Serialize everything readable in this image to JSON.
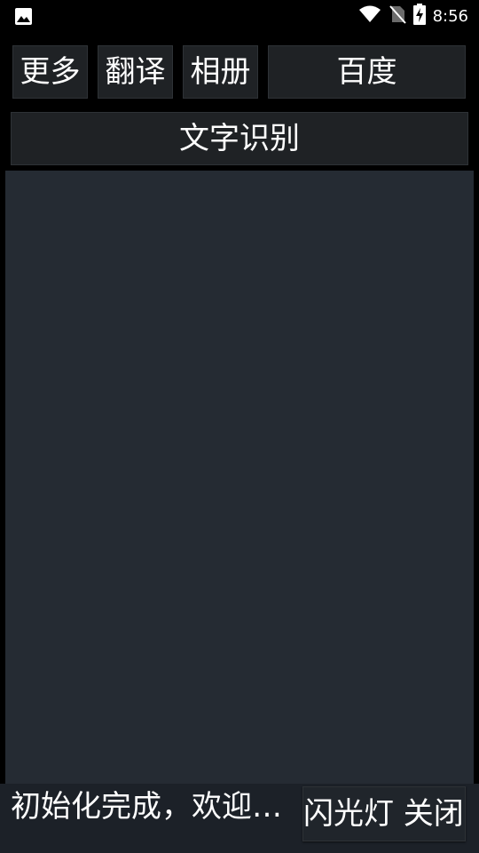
{
  "status_bar": {
    "time": "8:56",
    "left_icon": "image-icon",
    "right_icons": [
      "wifi-icon",
      "no-sim-icon",
      "battery-charging-icon"
    ]
  },
  "toolbar": {
    "more_label": "更多",
    "translate_label": "翻译",
    "album_label": "相册",
    "baidu_label": "百度"
  },
  "ocr_button_label": "文字识别",
  "bottom_bar": {
    "status_message": "初始化完成，欢迎…",
    "flash_button_label": "闪光灯 关闭"
  }
}
